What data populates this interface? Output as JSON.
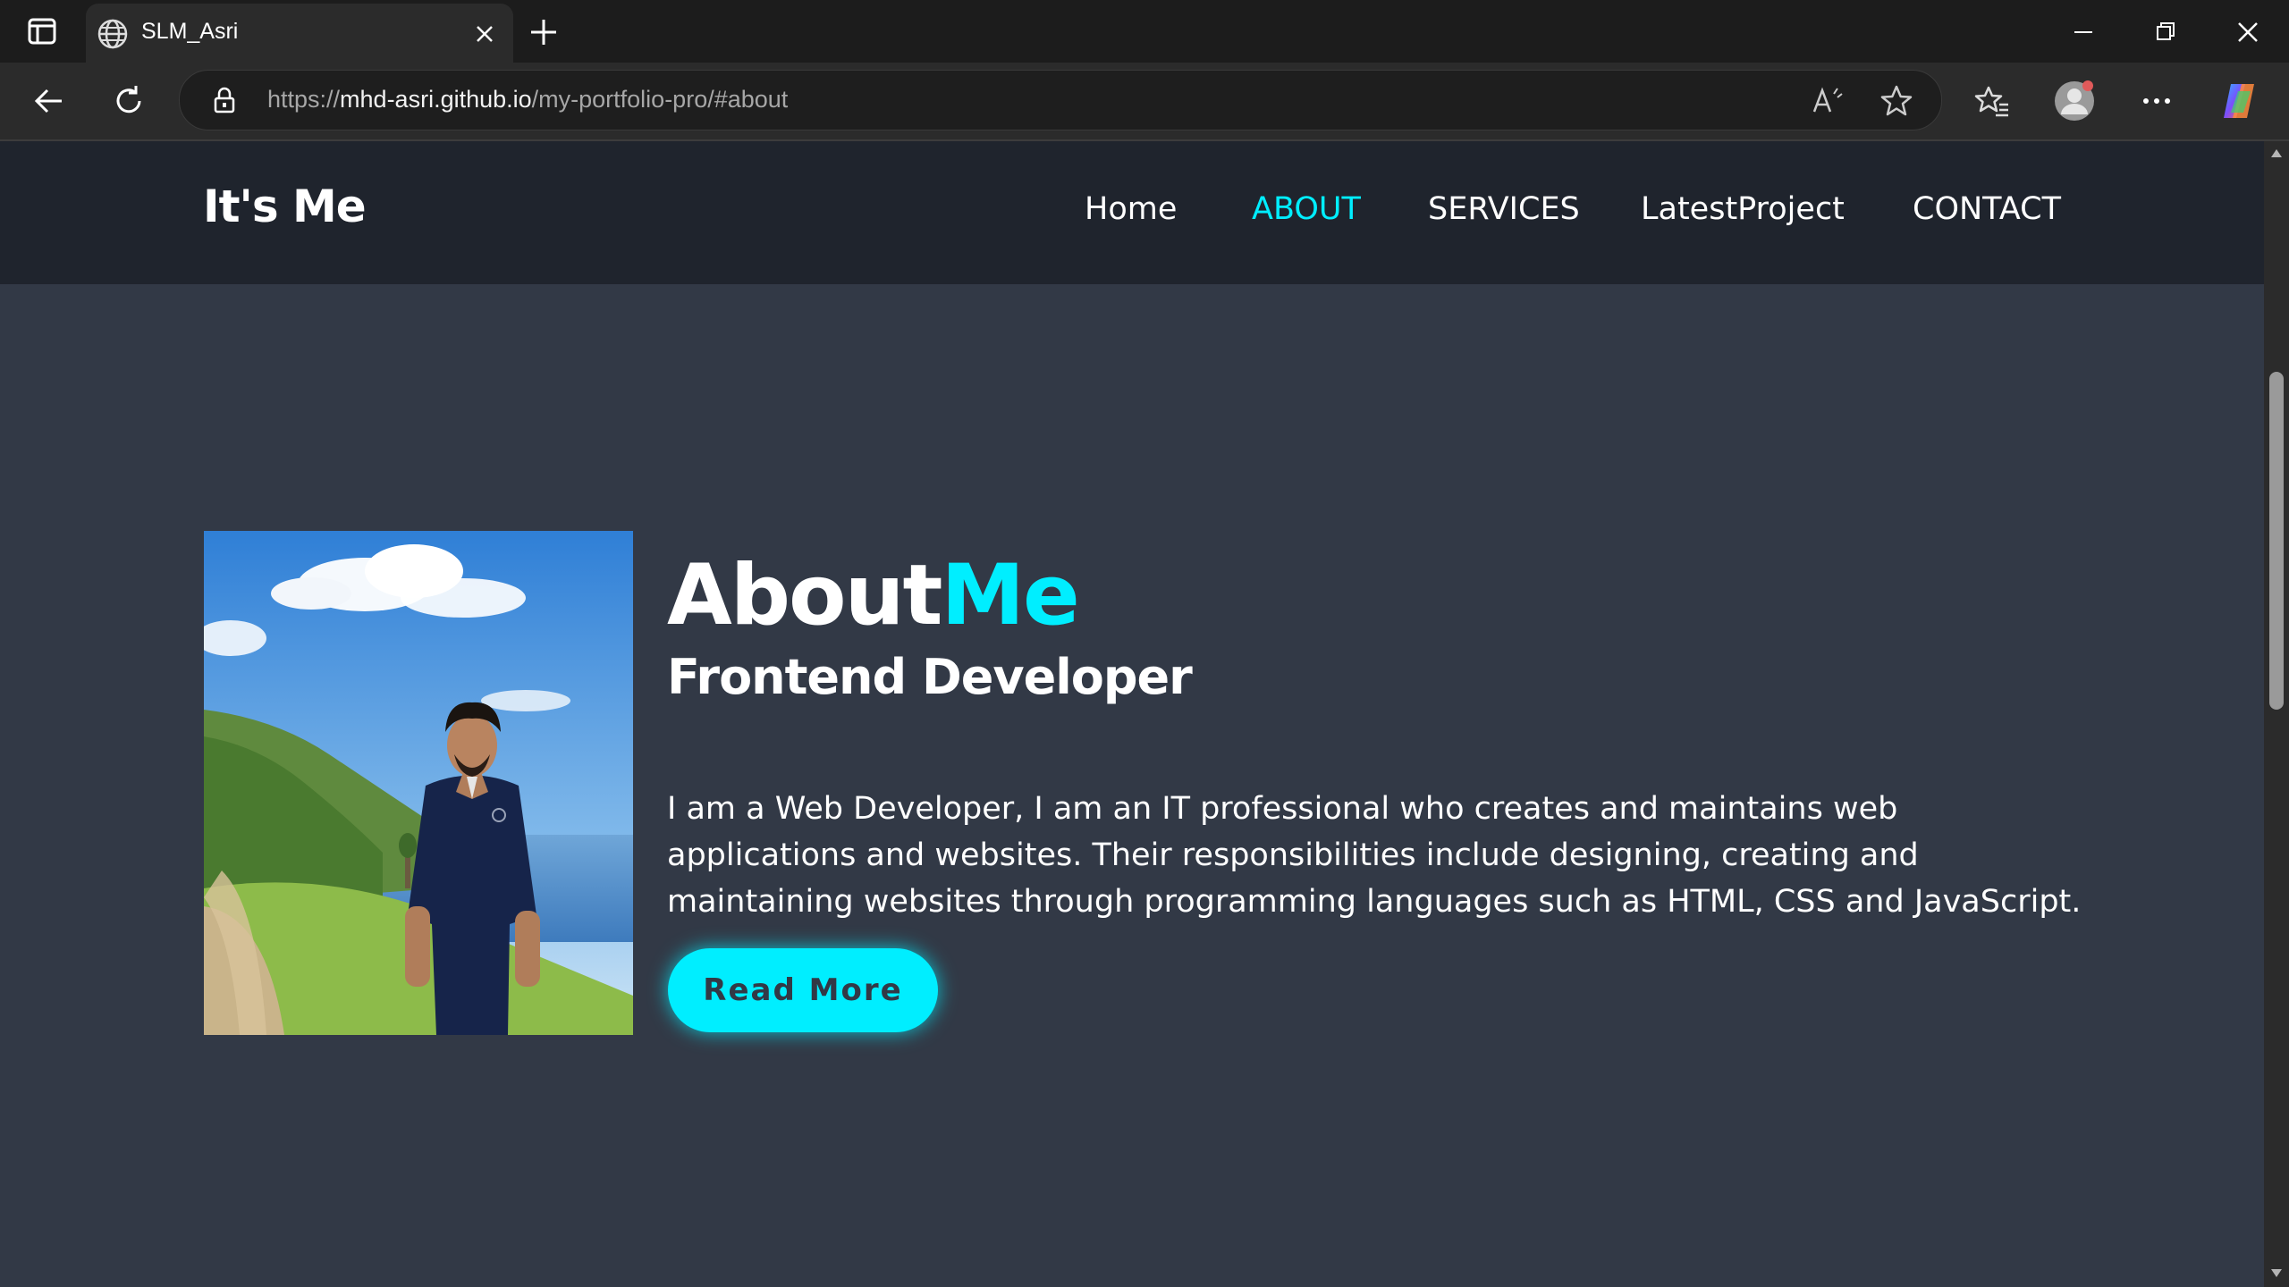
{
  "browser": {
    "tab_title": "SLM_Asri",
    "url_scheme": "https://",
    "url_host": "mhd-asri.github.io",
    "url_path": "/my-portfolio-pro/#about"
  },
  "site": {
    "logo": "It's Me",
    "nav": [
      {
        "label": "Home",
        "active": false
      },
      {
        "label": "ABOUT",
        "active": true
      },
      {
        "label": "SERVICES",
        "active": false
      },
      {
        "label": "LatestProject",
        "active": false
      },
      {
        "label": "CONTACT",
        "active": false
      }
    ],
    "accent_color": "#00eeff",
    "bg_color": "#323946",
    "header_color": "#1f242d"
  },
  "about": {
    "heading_main": "About",
    "heading_accent": "Me",
    "subheading": "Frontend Developer",
    "paragraph": "I am a Web Developer, I am an IT professional who creates and maintains web applications and websites. Their responsibilities include designing, creating and maintaining websites through programming languages such as HTML, CSS and JavaScript.",
    "button_label": "Read More"
  },
  "icons": {
    "tab_favicon": "globe-icon",
    "back": "back-arrow-icon",
    "reload": "reload-icon",
    "lock": "lock-icon",
    "read_aloud": "read-aloud-icon",
    "favorite": "star-icon",
    "favorites_list": "favorites-icon",
    "profile": "profile-icon",
    "more": "more-icon",
    "copilot": "copilot-icon"
  }
}
